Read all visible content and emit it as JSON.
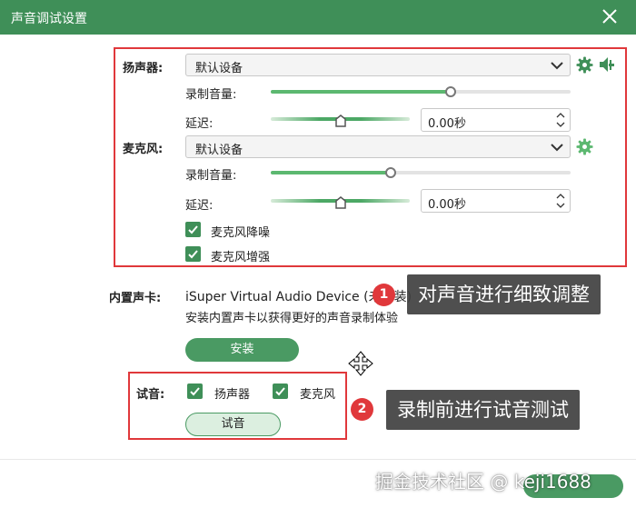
{
  "window": {
    "title": "声音调试设置"
  },
  "speaker": {
    "label": "扬声器:",
    "device": "默认设备",
    "volume_label": "录制音量:",
    "volume_level": 0.6,
    "delay_label": "延迟:",
    "delay_value": "0.00秒"
  },
  "mic": {
    "label": "麦克风:",
    "device": "默认设备",
    "volume_label": "录制音量:",
    "volume_level": 0.4,
    "delay_label": "延迟:",
    "delay_value": "0.00秒",
    "noise_reduction": {
      "label": "麦克风降噪",
      "checked": true
    },
    "enhance": {
      "label": "麦克风增强",
      "checked": true
    }
  },
  "soundcard": {
    "label": "内置声卡:",
    "device": "iSuper Virtual Audio Device (未安装)",
    "hint": "安装内置声卡以获得更好的声音录制体验",
    "install_label": "安装"
  },
  "audio_test": {
    "label": "试音:",
    "speaker_label": "扬声器",
    "speaker_checked": true,
    "mic_label": "麦克风",
    "mic_checked": true,
    "button_label": "试音"
  },
  "annotations": [
    {
      "badge": "1",
      "text": "对声音进行细致调整"
    },
    {
      "badge": "2",
      "text": "录制前进行试音测试"
    }
  ],
  "watermark": "掘金技术社区 @ keji1688",
  "colors": {
    "brand": "#3f8f58",
    "slider": "#5cb870",
    "annotation": "#e0383b"
  }
}
